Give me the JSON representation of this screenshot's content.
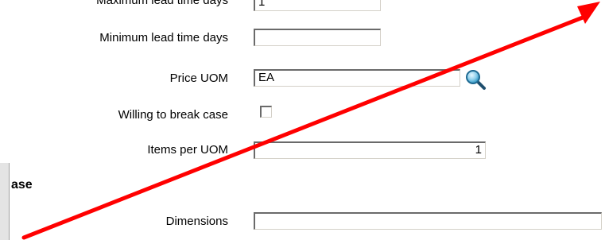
{
  "form": {
    "fields": [
      {
        "label": "Maximum lead time days",
        "value": "1"
      },
      {
        "label": "Minimum lead time days",
        "value": ""
      },
      {
        "label": "Price UOM",
        "value": "EA",
        "lookup_icon": "magnifier-icon"
      },
      {
        "label": "Willing to break case",
        "checked": false
      },
      {
        "label": "Items per UOM",
        "value": "1"
      }
    ],
    "section": {
      "title": "ase",
      "fields": [
        {
          "label": "Dimensions",
          "value": ""
        }
      ]
    }
  },
  "annotation": {
    "color": "#ff0000",
    "shape": "arrow"
  }
}
